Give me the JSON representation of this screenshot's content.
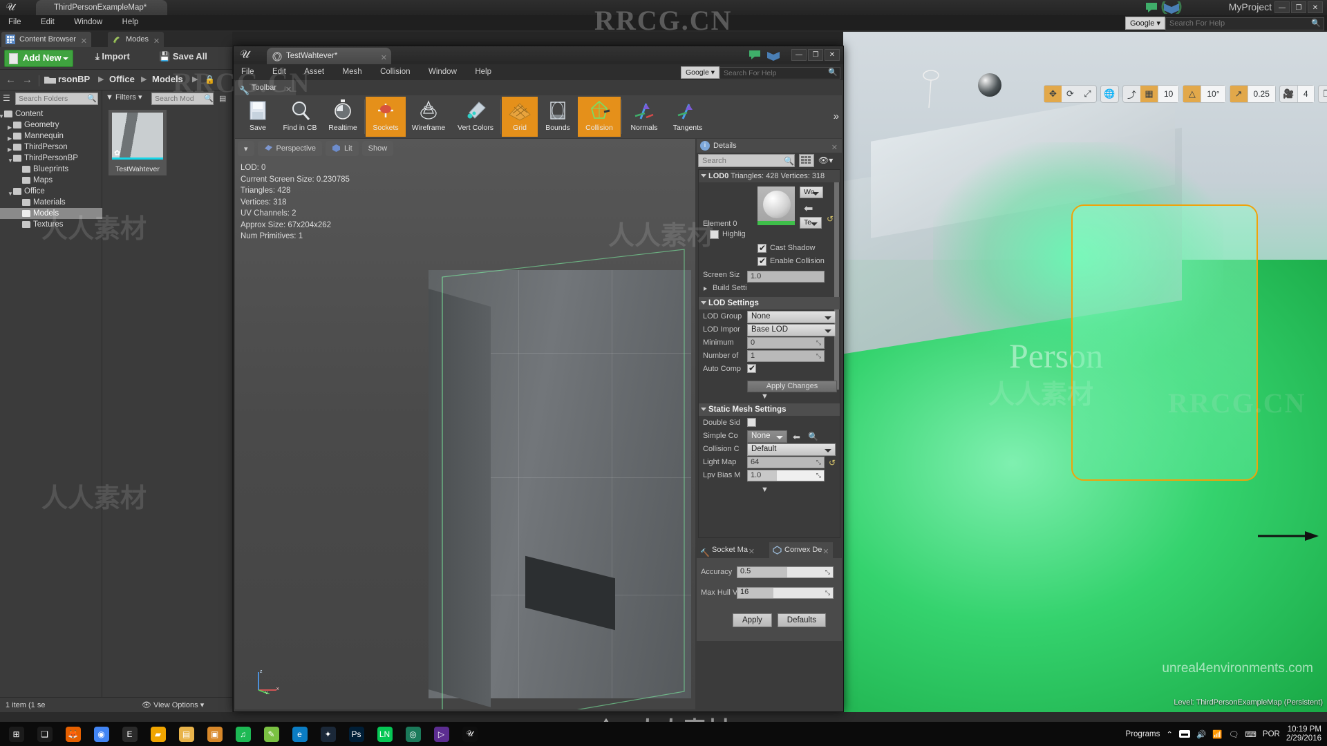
{
  "main_window": {
    "title": "ThirdPersonExampleMap*",
    "project_name": "MyProject",
    "menu": [
      "File",
      "Edit",
      "Window",
      "Help"
    ],
    "help_search": {
      "engine": "Google",
      "placeholder": "Search For Help"
    },
    "window_buttons": {
      "minimize": "—",
      "maximize": "❐",
      "close": "✕"
    }
  },
  "content_browser": {
    "tabs": [
      {
        "label": "Content Browser",
        "icon": "grid-icon",
        "active": true
      },
      {
        "label": "Modes",
        "icon": "modes-icon",
        "active": false
      }
    ],
    "toolbar": {
      "add_new": "Add New",
      "import": "Import",
      "save_all": "Save All"
    },
    "breadcrumb": [
      "rsonBP",
      "Office",
      "Models"
    ],
    "folder_search_placeholder": "Search Folders",
    "asset_search_placeholder": "Search Mod",
    "filters_label": "Filters",
    "tree": [
      {
        "label": "Content",
        "depth": 0,
        "expanded": true,
        "selected": false
      },
      {
        "label": "Geometry",
        "depth": 1,
        "expanded": false,
        "selected": false
      },
      {
        "label": "Mannequin",
        "depth": 1,
        "expanded": false,
        "selected": false
      },
      {
        "label": "ThirdPerson",
        "depth": 1,
        "expanded": false,
        "selected": false
      },
      {
        "label": "ThirdPersonBP",
        "depth": 1,
        "expanded": true,
        "selected": false
      },
      {
        "label": "Blueprints",
        "depth": 2,
        "expanded": null,
        "selected": false
      },
      {
        "label": "Maps",
        "depth": 2,
        "expanded": null,
        "selected": false
      },
      {
        "label": "Office",
        "depth": 1,
        "expanded": true,
        "selected": false
      },
      {
        "label": "Materials",
        "depth": 2,
        "expanded": null,
        "selected": false
      },
      {
        "label": "Models",
        "depth": 2,
        "expanded": null,
        "selected": true
      },
      {
        "label": "Textures",
        "depth": 2,
        "expanded": null,
        "selected": false
      }
    ],
    "assets": [
      {
        "name": "TestWahtever"
      }
    ],
    "status": "1 item (1 se",
    "view_options": "View Options"
  },
  "mesh_editor": {
    "tab_title": "TestWahtever*",
    "menu": [
      "File",
      "Edit",
      "Asset",
      "Mesh",
      "Collision",
      "Window",
      "Help"
    ],
    "help_search": {
      "engine": "Google",
      "placeholder": "Search For Help"
    },
    "toolbar_tab": "Toolbar",
    "toolbar": [
      {
        "label": "Save",
        "icon": "floppy-disk-icon",
        "active": false
      },
      {
        "label": "Find in CB",
        "icon": "magnifier-icon",
        "active": false
      },
      {
        "label": "Realtime",
        "icon": "stopwatch-icon",
        "active": false
      },
      {
        "label": "Sockets",
        "icon": "socket-icon",
        "active": true
      },
      {
        "label": "Wireframe",
        "icon": "wireframe-icon",
        "active": false
      },
      {
        "label": "Vert Colors",
        "icon": "vertex-color-icon",
        "active": false
      },
      {
        "label": "Grid",
        "icon": "grid-icon",
        "active": true
      },
      {
        "label": "Bounds",
        "icon": "bounds-icon",
        "active": false
      },
      {
        "label": "Collision",
        "icon": "collision-icon",
        "active": true
      },
      {
        "label": "Normals",
        "icon": "normals-icon",
        "active": false
      },
      {
        "label": "Tangents",
        "icon": "tangents-icon",
        "active": false
      }
    ],
    "viewport": {
      "buttons": [
        "Perspective",
        "Lit",
        "Show"
      ],
      "stats": [
        "LOD: 0",
        "Current Screen Size: 0.230785",
        "Triangles: 428",
        "Vertices: 318",
        "UV Channels: 2",
        "Approx Size: 67x204x262",
        "Num Primitives: 1"
      ]
    },
    "details": {
      "title": "Details",
      "search_placeholder": "Search",
      "lod0": {
        "label": "LOD0",
        "triangles": "Triangles: 428",
        "vertices": "Vertices: 318"
      },
      "element": {
        "label": "Element 0",
        "highlight_label": "Highlig",
        "world_dropdown": "Wo",
        "texture_dropdown": "Te",
        "cast_shadow": {
          "label": "Cast Shadow",
          "checked": true
        },
        "enable_collision": {
          "label": "Enable Collision",
          "checked": true
        }
      },
      "screen_size": {
        "label": "Screen Siz",
        "value": "1.0"
      },
      "build_settings": "Build Setti",
      "lod_settings": {
        "header": "LOD Settings",
        "rows": [
          {
            "label": "LOD Group",
            "type": "combo",
            "value": "None"
          },
          {
            "label": "LOD Impor",
            "type": "combo",
            "value": "Base LOD"
          },
          {
            "label": "Minimum",
            "type": "text",
            "value": "0"
          },
          {
            "label": "Number of",
            "type": "text",
            "value": "1"
          },
          {
            "label": "Auto Comp",
            "type": "check",
            "value": true
          }
        ],
        "apply_changes": "Apply Changes"
      },
      "static_mesh_settings": {
        "header": "Static Mesh Settings",
        "rows": [
          {
            "label": "Double Sid",
            "type": "check",
            "value": false
          },
          {
            "label": "Simple Co",
            "type": "combo-small",
            "value": "None"
          },
          {
            "label": "Collision C",
            "type": "combo",
            "value": "Default"
          },
          {
            "label": "Light Map",
            "type": "text",
            "value": "64"
          },
          {
            "label": "Lpv Bias M",
            "type": "slider",
            "value": "1.0"
          }
        ]
      }
    },
    "bottom_tabs": [
      {
        "label": "Socket Ma",
        "icon": "socket-icon",
        "active": false
      },
      {
        "label": "Convex De",
        "icon": "hull-icon",
        "active": true
      }
    ],
    "convex_decomposition": {
      "accuracy": {
        "label": "Accuracy",
        "value": "0.5",
        "fill_pct": 52
      },
      "max_hull": {
        "label": "Max Hull V",
        "value": "16",
        "fill_pct": 38
      },
      "apply": "Apply",
      "defaults": "Defaults"
    }
  },
  "level_viewport": {
    "snap_toolbar": {
      "grid_value": "10",
      "rotation_value": "10°",
      "scale_value": "0.25",
      "camera_speed": "4"
    },
    "status": "Level:  ThirdPersonExampleMap (Persistent)",
    "watermark_site": "unreal4environments.com",
    "scene_text": "Person"
  },
  "taskbar": {
    "programs_label": "Programs",
    "locale": "POR",
    "time": "10:19 PM",
    "date": "2/29/2016",
    "apps": [
      "start",
      "task-view",
      "firefox",
      "chrome",
      "epic-launcher",
      "explorer-yellow",
      "folder",
      "file-manager",
      "spotify",
      "notes",
      "edge",
      "steam",
      "photoshop",
      "line",
      "obs",
      "visual-studio",
      "unreal"
    ]
  },
  "watermarks": {
    "brand": "RRCG.CN",
    "cn": "人人素材",
    "center": "人人素材"
  }
}
